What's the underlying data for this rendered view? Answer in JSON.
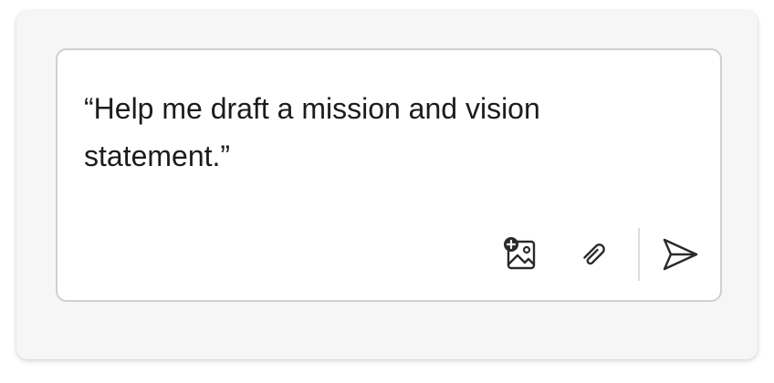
{
  "composer": {
    "text": "“Help me draft a mission and vision statement.”"
  },
  "toolbar": {
    "icons": [
      "add-image-icon",
      "paperclip-icon",
      "send-icon"
    ]
  }
}
